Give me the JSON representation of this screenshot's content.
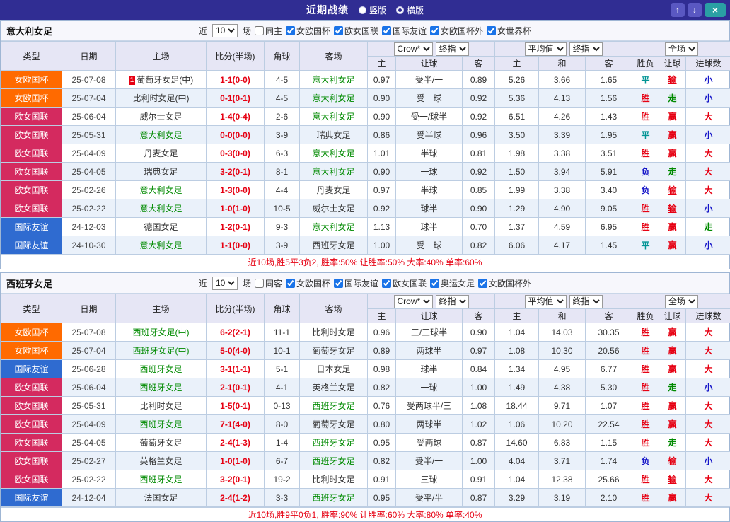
{
  "titlebar": {
    "title": "近期战绩",
    "radios": [
      {
        "label": "竖版",
        "selected": false
      },
      {
        "label": "横版",
        "selected": true
      }
    ],
    "buttons": {
      "up": "↑",
      "down": "↓",
      "close": "×"
    }
  },
  "colors": {
    "titlebar_bg": "#302d93",
    "type_badges": {
      "女欧国杯": "#ff6a00",
      "欧女国联": "#d42a5f",
      "国际友谊": "#2f6bd0"
    },
    "results": {
      "胜": "#e60012",
      "平": "#009494",
      "负": "#1515c8",
      "赢": "#e60012",
      "输": "#e60012",
      "走": "#008a00",
      "大": "#e60012",
      "小": "#1515c8"
    },
    "focus_team": "#008a00",
    "score": "#e60012"
  },
  "table": {
    "main_headers": [
      "类型",
      "日期",
      "主场",
      "比分(半场)",
      "角球",
      "客场"
    ],
    "sub_headers": [
      "主",
      "让球",
      "客",
      "主",
      "和",
      "客",
      "胜负",
      "让球",
      "进球数"
    ]
  },
  "sections": [
    {
      "team": "意大利女足",
      "filter": {
        "near_label": "近",
        "count": "10",
        "games_label": "场",
        "same_venue": {
          "label": "同主",
          "checked": false
        },
        "leagues": [
          {
            "label": "女欧国杯",
            "checked": true
          },
          {
            "label": "欧女国联",
            "checked": true
          },
          {
            "label": "国际友谊",
            "checked": true
          },
          {
            "label": "女欧国杯外",
            "checked": true
          },
          {
            "label": "女世界杯",
            "checked": true
          }
        ]
      },
      "selects": {
        "company": "Crow*",
        "company_time": "终指",
        "average": "平均值",
        "average_time": "终指",
        "scope": "全场"
      },
      "rows": [
        {
          "type": "女欧国杯",
          "date": "25-07-08",
          "home": "葡萄牙女足(中)",
          "home_focus": false,
          "home_rank": "1",
          "score": "1-1(0-0)",
          "corner": "4-5",
          "away": "意大利女足",
          "away_focus": true,
          "odds": [
            "0.97",
            "受半/一",
            "0.89"
          ],
          "avg": [
            "5.26",
            "3.66",
            "1.65"
          ],
          "results": [
            "平",
            "输",
            "小"
          ]
        },
        {
          "type": "女欧国杯",
          "date": "25-07-04",
          "home": "比利时女足(中)",
          "home_focus": false,
          "score": "0-1(0-1)",
          "corner": "4-5",
          "away": "意大利女足",
          "away_focus": true,
          "odds": [
            "0.90",
            "受一球",
            "0.92"
          ],
          "avg": [
            "5.36",
            "4.13",
            "1.56"
          ],
          "results": [
            "胜",
            "走",
            "小"
          ]
        },
        {
          "type": "欧女国联",
          "date": "25-06-04",
          "home": "威尔士女足",
          "home_focus": false,
          "score": "1-4(0-4)",
          "corner": "2-6",
          "away": "意大利女足",
          "away_focus": true,
          "odds": [
            "0.90",
            "受一/球半",
            "0.92"
          ],
          "avg": [
            "6.51",
            "4.26",
            "1.43"
          ],
          "results": [
            "胜",
            "赢",
            "大"
          ]
        },
        {
          "type": "欧女国联",
          "date": "25-05-31",
          "home": "意大利女足",
          "home_focus": true,
          "score": "0-0(0-0)",
          "corner": "3-9",
          "away": "瑞典女足",
          "away_focus": false,
          "odds": [
            "0.86",
            "受半球",
            "0.96"
          ],
          "avg": [
            "3.50",
            "3.39",
            "1.95"
          ],
          "results": [
            "平",
            "赢",
            "小"
          ]
        },
        {
          "type": "欧女国联",
          "date": "25-04-09",
          "home": "丹麦女足",
          "home_focus": false,
          "score": "0-3(0-0)",
          "corner": "6-3",
          "away": "意大利女足",
          "away_focus": true,
          "odds": [
            "1.01",
            "半球",
            "0.81"
          ],
          "avg": [
            "1.98",
            "3.38",
            "3.51"
          ],
          "results": [
            "胜",
            "赢",
            "大"
          ]
        },
        {
          "type": "欧女国联",
          "date": "25-04-05",
          "home": "瑞典女足",
          "home_focus": false,
          "score": "3-2(0-1)",
          "corner": "8-1",
          "away": "意大利女足",
          "away_focus": true,
          "odds": [
            "0.90",
            "一球",
            "0.92"
          ],
          "avg": [
            "1.50",
            "3.94",
            "5.91"
          ],
          "results": [
            "负",
            "走",
            "大"
          ]
        },
        {
          "type": "欧女国联",
          "date": "25-02-26",
          "home": "意大利女足",
          "home_focus": true,
          "score": "1-3(0-0)",
          "corner": "4-4",
          "away": "丹麦女足",
          "away_focus": false,
          "odds": [
            "0.97",
            "半球",
            "0.85"
          ],
          "avg": [
            "1.99",
            "3.38",
            "3.40"
          ],
          "results": [
            "负",
            "输",
            "大"
          ]
        },
        {
          "type": "欧女国联",
          "date": "25-02-22",
          "home": "意大利女足",
          "home_focus": true,
          "score": "1-0(1-0)",
          "corner": "10-5",
          "away": "威尔士女足",
          "away_focus": false,
          "odds": [
            "0.92",
            "球半",
            "0.90"
          ],
          "avg": [
            "1.29",
            "4.90",
            "9.05"
          ],
          "results": [
            "胜",
            "输",
            "小"
          ]
        },
        {
          "type": "国际友谊",
          "date": "24-12-03",
          "home": "德国女足",
          "home_focus": false,
          "score": "1-2(0-1)",
          "corner": "9-3",
          "away": "意大利女足",
          "away_focus": true,
          "odds": [
            "1.13",
            "球半",
            "0.70"
          ],
          "avg": [
            "1.37",
            "4.59",
            "6.95"
          ],
          "results": [
            "胜",
            "赢",
            "走"
          ]
        },
        {
          "type": "国际友谊",
          "date": "24-10-30",
          "home": "意大利女足",
          "home_focus": true,
          "score": "1-1(0-0)",
          "corner": "3-9",
          "away": "西班牙女足",
          "away_focus": false,
          "odds": [
            "1.00",
            "受一球",
            "0.82"
          ],
          "avg": [
            "6.06",
            "4.17",
            "1.45"
          ],
          "results": [
            "平",
            "赢",
            "小"
          ]
        }
      ],
      "summary": "近10场,胜5平3负2, 胜率:50% 让胜率:50% 大率:40% 单率:60%"
    },
    {
      "team": "西班牙女足",
      "filter": {
        "near_label": "近",
        "count": "10",
        "games_label": "场",
        "same_venue": {
          "label": "同客",
          "checked": false
        },
        "leagues": [
          {
            "label": "女欧国杯",
            "checked": true
          },
          {
            "label": "国际友谊",
            "checked": true
          },
          {
            "label": "欧女国联",
            "checked": true
          },
          {
            "label": "奥运女足",
            "checked": true
          },
          {
            "label": "女欧国杯外",
            "checked": true
          }
        ]
      },
      "selects": {
        "company": "Crow*",
        "company_time": "终指",
        "average": "平均值",
        "average_time": "终指",
        "scope": "全场"
      },
      "rows": [
        {
          "type": "女欧国杯",
          "date": "25-07-08",
          "home": "西班牙女足(中)",
          "home_focus": true,
          "score": "6-2(2-1)",
          "corner": "11-1",
          "away": "比利时女足",
          "away_focus": false,
          "odds": [
            "0.96",
            "三/三球半",
            "0.90"
          ],
          "avg": [
            "1.04",
            "14.03",
            "30.35"
          ],
          "results": [
            "胜",
            "赢",
            "大"
          ]
        },
        {
          "type": "女欧国杯",
          "date": "25-07-04",
          "home": "西班牙女足(中)",
          "home_focus": true,
          "score": "5-0(4-0)",
          "corner": "10-1",
          "away": "葡萄牙女足",
          "away_focus": false,
          "odds": [
            "0.89",
            "两球半",
            "0.97"
          ],
          "avg": [
            "1.08",
            "10.30",
            "20.56"
          ],
          "results": [
            "胜",
            "赢",
            "大"
          ]
        },
        {
          "type": "国际友谊",
          "date": "25-06-28",
          "home": "西班牙女足",
          "home_focus": true,
          "score": "3-1(1-1)",
          "corner": "5-1",
          "away": "日本女足",
          "away_focus": false,
          "odds": [
            "0.98",
            "球半",
            "0.84"
          ],
          "avg": [
            "1.34",
            "4.95",
            "6.77"
          ],
          "results": [
            "胜",
            "赢",
            "大"
          ]
        },
        {
          "type": "欧女国联",
          "date": "25-06-04",
          "home": "西班牙女足",
          "home_focus": true,
          "score": "2-1(0-1)",
          "corner": "4-1",
          "away": "英格兰女足",
          "away_focus": false,
          "odds": [
            "0.82",
            "一球",
            "1.00"
          ],
          "avg": [
            "1.49",
            "4.38",
            "5.30"
          ],
          "results": [
            "胜",
            "走",
            "小"
          ]
        },
        {
          "type": "欧女国联",
          "date": "25-05-31",
          "home": "比利时女足",
          "home_focus": false,
          "score": "1-5(0-1)",
          "corner": "0-13",
          "away": "西班牙女足",
          "away_focus": true,
          "odds": [
            "0.76",
            "受两球半/三",
            "1.08"
          ],
          "avg": [
            "18.44",
            "9.71",
            "1.07"
          ],
          "results": [
            "胜",
            "赢",
            "大"
          ]
        },
        {
          "type": "欧女国联",
          "date": "25-04-09",
          "home": "西班牙女足",
          "home_focus": true,
          "score": "7-1(4-0)",
          "corner": "8-0",
          "away": "葡萄牙女足",
          "away_focus": false,
          "odds": [
            "0.80",
            "两球半",
            "1.02"
          ],
          "avg": [
            "1.06",
            "10.20",
            "22.54"
          ],
          "results": [
            "胜",
            "赢",
            "大"
          ]
        },
        {
          "type": "欧女国联",
          "date": "25-04-05",
          "home": "葡萄牙女足",
          "home_focus": false,
          "score": "2-4(1-3)",
          "corner": "1-4",
          "away": "西班牙女足",
          "away_focus": true,
          "odds": [
            "0.95",
            "受两球",
            "0.87"
          ],
          "avg": [
            "14.60",
            "6.83",
            "1.15"
          ],
          "results": [
            "胜",
            "走",
            "大"
          ]
        },
        {
          "type": "欧女国联",
          "date": "25-02-27",
          "home": "英格兰女足",
          "home_focus": false,
          "score": "1-0(1-0)",
          "corner": "6-7",
          "away": "西班牙女足",
          "away_focus": true,
          "odds": [
            "0.82",
            "受半/一",
            "1.00"
          ],
          "avg": [
            "4.04",
            "3.71",
            "1.74"
          ],
          "results": [
            "负",
            "输",
            "小"
          ]
        },
        {
          "type": "欧女国联",
          "date": "25-02-22",
          "home": "西班牙女足",
          "home_focus": true,
          "score": "3-2(0-1)",
          "corner": "19-2",
          "away": "比利时女足",
          "away_focus": false,
          "odds": [
            "0.91",
            "三球",
            "0.91"
          ],
          "avg": [
            "1.04",
            "12.38",
            "25.66"
          ],
          "results": [
            "胜",
            "输",
            "大"
          ]
        },
        {
          "type": "国际友谊",
          "date": "24-12-04",
          "home": "法国女足",
          "home_focus": false,
          "score": "2-4(1-2)",
          "corner": "3-3",
          "away": "西班牙女足",
          "away_focus": true,
          "odds": [
            "0.95",
            "受平/半",
            "0.87"
          ],
          "avg": [
            "3.29",
            "3.19",
            "2.10"
          ],
          "results": [
            "胜",
            "赢",
            "大"
          ]
        }
      ],
      "summary": "近10场,胜9平0负1, 胜率:90% 让胜率:60% 大率:80% 单率:40%"
    }
  ]
}
